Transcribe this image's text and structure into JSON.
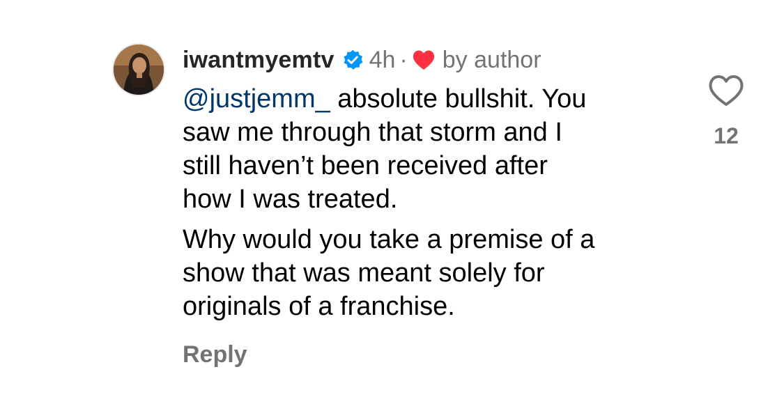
{
  "comment": {
    "username": "iwantmyemtv",
    "verified_icon": "verified-badge-icon",
    "time_ago": "4h",
    "separator": "·",
    "author_heart_icon": "heart-filled-icon",
    "author_like_label": "by author",
    "mention": "@justjemm_",
    "paragraph1_lines": [
      " absolute bullshit. You",
      "saw me through that storm and I",
      "still haven’t been received after",
      "how I was treated."
    ],
    "paragraph2_lines": [
      "Why would you take a premise of a",
      "show that was meant solely for",
      "originals of a franchise."
    ],
    "reply_label": "Reply",
    "like_icon": "heart-outline-icon",
    "like_count": "12"
  },
  "colors": {
    "username": "#262626",
    "muted": "#737373",
    "mention": "#00376b",
    "verified": "#0095f6",
    "heart": "#ff3040"
  }
}
